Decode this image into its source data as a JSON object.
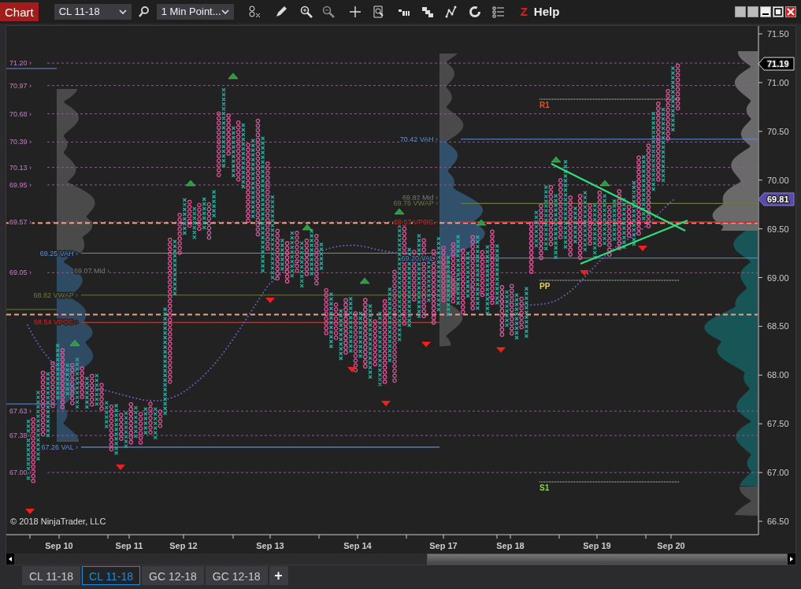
{
  "toolbar": {
    "title": "Chart",
    "instrument": "CL 11-18",
    "interval": "1 Min Point...",
    "logo": "Z",
    "help": "Help"
  },
  "chart": {
    "price_ticks": [
      "71.50",
      "71.00",
      "70.50",
      "70.00",
      "69.50",
      "69.00",
      "68.50",
      "68.00",
      "67.50",
      "67.00",
      "66.50"
    ],
    "date_labels": [
      "Sep 10",
      "Sep 11",
      "Sep 12",
      "Sep 13",
      "Sep 14",
      "Sep 17",
      "Sep 18",
      "Sep 19",
      "Sep 20"
    ],
    "levels": [
      {
        "label": "71.20 ›"
      },
      {
        "label": "70.97 ›"
      },
      {
        "label": "70.68 ›"
      },
      {
        "label": "70.39 ›"
      },
      {
        "label": "70.13 ›"
      },
      {
        "label": "69.95 ›"
      },
      {
        "label": "69.57 ›"
      },
      {
        "label": "69.05 ›"
      },
      {
        "label": "67.63 ›"
      },
      {
        "label": "67.38 ›"
      },
      {
        "label": "67.00 ›"
      }
    ],
    "left_profile_labels": [
      {
        "label": "69.25 VAH ›",
        "kind": "vah"
      },
      {
        "label": "69.07 Mid ›",
        "kind": "mid"
      },
      {
        "label": "68.82 VWAP ›",
        "kind": "vwap"
      },
      {
        "label": "68.54 VPOC ›",
        "kind": "vpoc"
      },
      {
        "label": "67.26 VAL ›",
        "kind": "val"
      }
    ],
    "mid_profile_labels": [
      {
        "label": "70.42 VAH ›",
        "kind": "vah"
      },
      {
        "label": "69.82 Mid ›",
        "kind": "mid"
      },
      {
        "label": "69.76 VWAP ›",
        "kind": "vwap"
      },
      {
        "label": "69.57 VPOC ›",
        "kind": "vpoc"
      },
      {
        "label": "69.20 VAL ›",
        "kind": "val"
      }
    ],
    "pivots": [
      {
        "label": "R1",
        "color": "#e8541e"
      },
      {
        "label": "PP",
        "color": "#e8d84a"
      },
      {
        "label": "S1",
        "color": "#8fd14f"
      }
    ],
    "markers": [
      {
        "label": "71.19",
        "kind": "last"
      },
      {
        "label": "69.81",
        "kind": "vwap"
      }
    ],
    "copyright": "© 2018 NinjaTrader, LLC"
  },
  "tabs": [
    {
      "label": "CL 11-18",
      "selected": false
    },
    {
      "label": "CL 11-18",
      "selected": true
    },
    {
      "label": "GC 12-18",
      "selected": false
    },
    {
      "label": "GC 12-18",
      "selected": false
    }
  ],
  "add_tab": "+"
}
